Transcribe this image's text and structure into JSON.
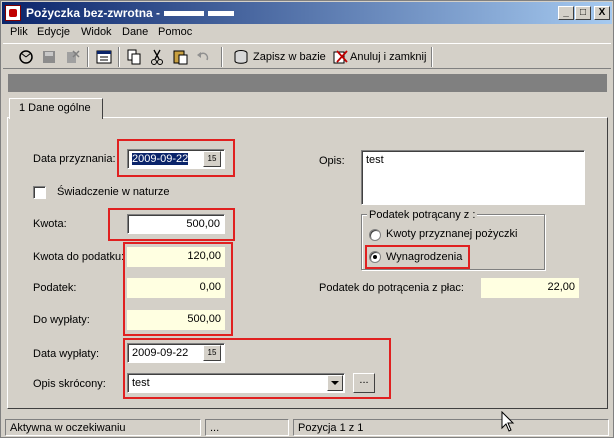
{
  "window": {
    "title": "Pożyczka bez-zwrotna -",
    "controls": [
      "_",
      "□",
      "X"
    ]
  },
  "menu": [
    "Plik",
    "Edycje",
    "Widok",
    "Dane",
    "Pomoc"
  ],
  "toolbar": {
    "save_label": "Zapisz w bazie",
    "cancel_label": "Anuluj i zamknij"
  },
  "tabs": [
    {
      "label": "1 Dane ogólne"
    }
  ],
  "form": {
    "data_przyznania_label": "Data przyznania:",
    "data_przyznania_value": "2009-09-22",
    "swiadczenie_label": "Świadczenie w naturze",
    "swiadczenie_checked": false,
    "kwota_label": "Kwota:",
    "kwota_value": "500,00",
    "kwota_do_podatku_label": "Kwota do podatku:",
    "kwota_do_podatku_value": "120,00",
    "podatek_label": "Podatek:",
    "podatek_value": "0,00",
    "do_wyplaty_label": "Do wypłaty:",
    "do_wyplaty_value": "500,00",
    "data_wyplaty_label": "Data wypłaty:",
    "data_wyplaty_value": "2009-09-22",
    "opis_skrocony_label": "Opis skrócony:",
    "opis_skrocony_value": "test",
    "opis_label": "Opis:",
    "opis_value": "test",
    "podatek_group_title": "Podatek potrącany z :",
    "radio_kwoty_label": "Kwoty przyznanej pożyczki",
    "radio_wynagrodzenia_label": "Wynagrodzenia",
    "selected_radio": "Wynagrodzenia",
    "podatek_do_potracenia_label": "Podatek do potrącenia z płac:",
    "podatek_do_potracenia_value": "22,00",
    "date_button_glyph": "15",
    "dots_label": "..."
  },
  "status": {
    "state": "Aktywna w oczekiwaniu",
    "middle": "...",
    "position": "Pozycja 1 z 1"
  },
  "colors": {
    "highlight": "#e02020",
    "readonly_field": "#ffffe1",
    "titlebar_start": "#0a246a"
  }
}
